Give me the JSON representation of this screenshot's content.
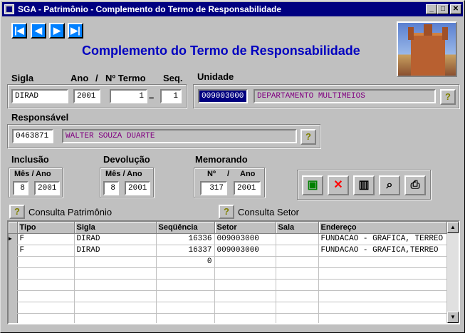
{
  "window": {
    "title": "SGA - Patrimônio - Complemento do Termo de Responsabilidade",
    "min_label": "_",
    "max_label": "□",
    "close_label": "✕"
  },
  "nav": {
    "first": "|◀",
    "prev": "◀",
    "next": "▶",
    "last": "▶|"
  },
  "heading": "Complemento do Termo de Responsabilidade",
  "labels": {
    "sigla": "Sigla",
    "ano": "Ano",
    "slash": "/",
    "n_termo": "Nº Termo",
    "seq": "Seq.",
    "unidade": "Unidade",
    "responsavel": "Responsável",
    "inclusao": "Inclusão",
    "devolucao": "Devolução",
    "memorando": "Memorando",
    "mes_ano": "Mês / Ano",
    "n": "Nº",
    "ano_small": "Ano",
    "dash": "–",
    "consulta_patrimonio": "Consulta Patrimônio",
    "consulta_setor": "Consulta Setor",
    "help": "?"
  },
  "fields": {
    "sigla": "DIRAD",
    "ano": "2001",
    "n_termo": "1",
    "seq": "1",
    "unidade_code": "009003000",
    "unidade_name": "DEPARTAMENTO MULTIMEIOS",
    "responsavel_code": "0463871",
    "responsavel_name": "WALTER SOUZA DUARTE",
    "inclusao_mes": "8",
    "inclusao_ano": "2001",
    "devolucao_mes": "8",
    "devolucao_ano": "2001",
    "memorando_n": "317",
    "memorando_ano": "2001"
  },
  "actions": {
    "save": "▣",
    "delete": "✕",
    "trash": "▥",
    "search": "⌕",
    "print": "⎙"
  },
  "colors": {
    "accent": "#0000c0",
    "titlebar": "#000080",
    "purple_text": "#800080",
    "delete_red": "#ff0000",
    "save_green": "#008000"
  },
  "table": {
    "columns": [
      "Tipo",
      "Sigla",
      "Seqüência",
      "Setor",
      "Sala",
      "Endereço"
    ],
    "rows": [
      [
        "F",
        "DIRAD",
        "16336",
        "009003000",
        "",
        "FUNDACAO - GRAFICA, TERREO"
      ],
      [
        "F",
        "DIRAD",
        "16337",
        "009003000",
        "",
        "FUNDACAO - GRAFICA,TERREO"
      ],
      [
        "",
        "",
        "0",
        "",
        "",
        ""
      ],
      [
        "",
        "",
        "",
        "",
        "",
        ""
      ],
      [
        "",
        "",
        "",
        "",
        "",
        ""
      ],
      [
        "",
        "",
        "",
        "",
        "",
        ""
      ],
      [
        "",
        "",
        "",
        "",
        "",
        ""
      ],
      [
        "",
        "",
        "",
        "",
        "",
        ""
      ]
    ],
    "current_row_marker": "▶",
    "scroll_up": "▲",
    "scroll_down": "▼"
  }
}
